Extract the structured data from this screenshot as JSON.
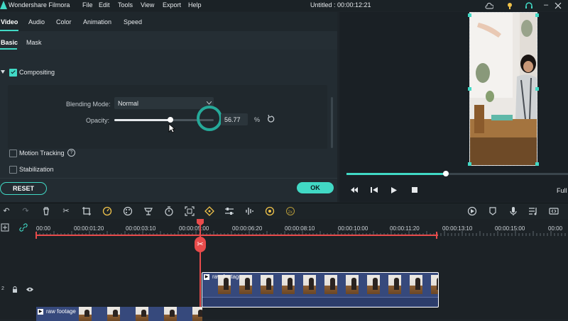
{
  "app": {
    "title": "Wondershare Filmora",
    "project_title": "Untitled : 00:00:12:21"
  },
  "menu": [
    "File",
    "Edit",
    "Tools",
    "View",
    "Export",
    "Help"
  ],
  "panel_tabs": [
    "Video",
    "Audio",
    "Color",
    "Animation",
    "Speed"
  ],
  "sub_tabs": [
    "Basic",
    "Mask"
  ],
  "compositing": {
    "label": "Compositing",
    "checked": true,
    "blending_mode_label": "Blending Mode:",
    "blending_mode_value": "Normal",
    "opacity_label": "Opacity:",
    "opacity_value": "56.77",
    "opacity_unit": "%",
    "opacity_fraction": 0.5677
  },
  "motion_tracking": {
    "label": "Motion Tracking",
    "checked": false
  },
  "stabilization": {
    "label": "Stabilization",
    "checked": false
  },
  "buttons": {
    "reset": "RESET",
    "ok": "OK"
  },
  "player": {
    "zoom": "Full",
    "progress_fraction": 0.45
  },
  "ruler": [
    "00:00",
    "00:00:01:20",
    "00:00:03:10",
    "00:00:05:00",
    "00:00:06:20",
    "00:00:08:10",
    "00:00:10:00",
    "00:00:11:20",
    "00:00:13:10",
    "00:00:15:00",
    "00:00"
  ],
  "tracks": {
    "track2_index": "2",
    "clip_upper_label": "raw footage",
    "clip_lower_label": "raw footage"
  },
  "colors": {
    "accent": "#41d9c5",
    "playhead": "#e84b4b",
    "clip_blue": "#3b4f8a"
  }
}
